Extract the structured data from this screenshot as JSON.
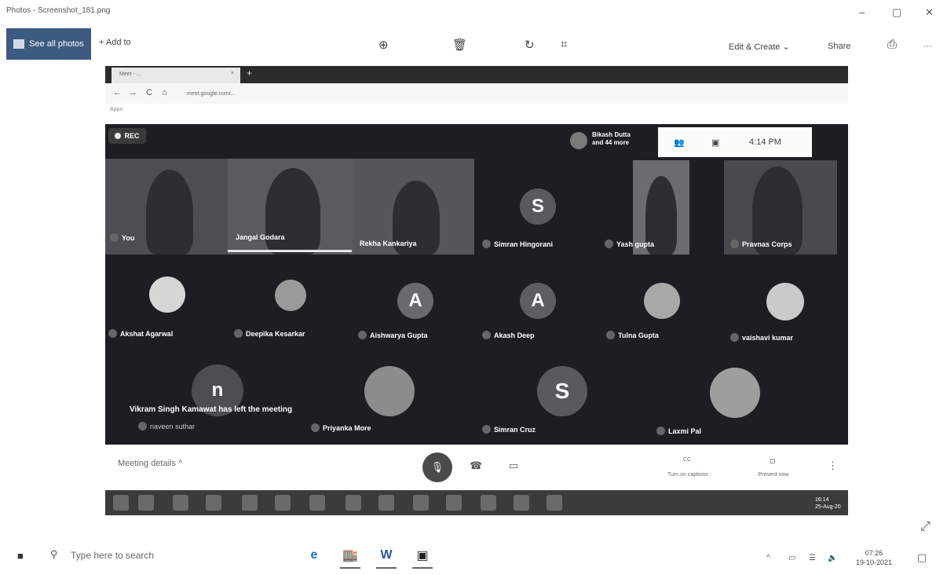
{
  "app": {
    "title": "Photos - Screenshot_181.png",
    "min": "–",
    "restore": "▢",
    "close": "✕"
  },
  "toolbar": {
    "see_all_photos": "See all photos",
    "add_to": "+ Add to",
    "zoom_icon": "⊕",
    "delete_icon": "🗑",
    "rotate_icon": "↻",
    "crop_icon": "⌗",
    "edit_create": "Edit & Create",
    "edit_chevron": "⌄",
    "share": "Share",
    "print_icon": "⎙",
    "more": "···"
  },
  "browser": {
    "tab_title": "Meet - ...",
    "tab_close": "×",
    "new_tab": "+",
    "back": "←",
    "forward": "→",
    "reload": "C",
    "home": "⌂",
    "url": "meet.google.com/...",
    "bookmark": "Apps"
  },
  "meet": {
    "rec_label": "REC",
    "host_line1": "Bikash Dutta",
    "host_line2": "and 44 more",
    "people_icon": "👥",
    "chat_icon": "▣",
    "time": "4:14 PM",
    "left_message": "Vikram Singh Kamawat has left the meeting",
    "participants": [
      {
        "name": "You",
        "kind": "video"
      },
      {
        "name": "Jangal Godara",
        "kind": "video"
      },
      {
        "name": "Rekha Kankariya",
        "kind": "video"
      },
      {
        "name": "Simran Hingorani",
        "kind": "avatar",
        "initial": "S",
        "color": "#5a5a5e"
      },
      {
        "name": "Yash gupta",
        "kind": "video"
      },
      {
        "name": "Pravnas Corps",
        "kind": "video"
      },
      {
        "name": "Akshat Agarwal",
        "kind": "photo"
      },
      {
        "name": "Deepika Kesarkar",
        "kind": "photo"
      },
      {
        "name": "Aishwarya Gupta",
        "kind": "avatar",
        "initial": "A",
        "color": "#6a6a6e"
      },
      {
        "name": "Akash Deep",
        "kind": "avatar",
        "initial": "A",
        "color": "#5e5e62"
      },
      {
        "name": "Tulna Gupta",
        "kind": "photo"
      },
      {
        "name": "vaishavi kumar",
        "kind": "photo"
      },
      {
        "name": "naveen suthar",
        "kind": "avatar",
        "initial": "n",
        "color": "#4e4e52"
      },
      {
        "name": "Priyanka More",
        "kind": "photo"
      },
      {
        "name": "Simran Cruz",
        "kind": "avatar",
        "initial": "S",
        "color": "#5a5a5e"
      },
      {
        "name": "Laxmi Pal",
        "kind": "photo"
      }
    ]
  },
  "controls": {
    "meeting_details": "Meeting details",
    "details_chevron": "^",
    "mic_icon": "🎙",
    "hangup_icon": "☎",
    "camera_icon": "▭",
    "captions_label": "Turn on captions",
    "present_label": "Present now",
    "more": "⋮",
    "captions_icon": "CC",
    "present_icon": "⊡"
  },
  "inner_taskbar": {
    "time": "16:14",
    "date": "25-Aug-20"
  },
  "taskbar": {
    "start_icon": "■",
    "search_icon": "⚲",
    "search_placeholder": "Type here to search",
    "edge_icon": "e",
    "store_icon": "🏬",
    "word_icon": "W",
    "photos_icon": "▣",
    "tray_chevron": "^",
    "battery_icon": "▭",
    "network_icon": "☰",
    "volume_icon": "🔈",
    "time": "07:26",
    "date": "19-10-2021",
    "notification_icon": "▢"
  },
  "expand_icon": "⤢"
}
